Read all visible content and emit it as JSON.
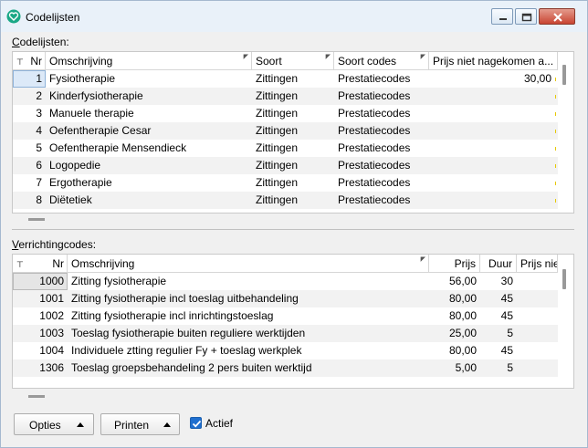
{
  "window": {
    "title": "Codelijsten"
  },
  "codelijsten": {
    "label_prefix": "C",
    "label_rest": "odelijsten:",
    "columns": [
      "Nr",
      "Omschrijving",
      "Soort",
      "Soort codes",
      "Prijs niet nagekomen a..."
    ],
    "rows": [
      {
        "nr": "1",
        "omschrijving": "Fysiotherapie",
        "soort": "Zittingen",
        "soort_codes": "Prestatiecodes",
        "prijs": "30,00"
      },
      {
        "nr": "2",
        "omschrijving": "Kinderfysiotherapie",
        "soort": "Zittingen",
        "soort_codes": "Prestatiecodes",
        "prijs": ""
      },
      {
        "nr": "3",
        "omschrijving": "Manuele therapie",
        "soort": "Zittingen",
        "soort_codes": "Prestatiecodes",
        "prijs": ""
      },
      {
        "nr": "4",
        "omschrijving": "Oefentherapie Cesar",
        "soort": "Zittingen",
        "soort_codes": "Prestatiecodes",
        "prijs": ""
      },
      {
        "nr": "5",
        "omschrijving": "Oefentherapie Mensendieck",
        "soort": "Zittingen",
        "soort_codes": "Prestatiecodes",
        "prijs": ""
      },
      {
        "nr": "6",
        "omschrijving": "Logopedie",
        "soort": "Zittingen",
        "soort_codes": "Prestatiecodes",
        "prijs": ""
      },
      {
        "nr": "7",
        "omschrijving": "Ergotherapie",
        "soort": "Zittingen",
        "soort_codes": "Prestatiecodes",
        "prijs": ""
      },
      {
        "nr": "8",
        "omschrijving": "Diëtetiek",
        "soort": "Zittingen",
        "soort_codes": "Prestatiecodes",
        "prijs": ""
      }
    ]
  },
  "verrichtingcodes": {
    "label_prefix": "V",
    "label_rest": "errichtingcodes:",
    "columns": [
      "Nr",
      "Omschrijving",
      "Prijs",
      "Duur",
      "Prijs nie"
    ],
    "rows": [
      {
        "nr": "1000",
        "omschrijving": "Zitting fysiotherapie",
        "prijs": "56,00",
        "duur": "30"
      },
      {
        "nr": "1001",
        "omschrijving": "Zitting fysiotherapie incl toeslag uitbehandeling",
        "prijs": "80,00",
        "duur": "45"
      },
      {
        "nr": "1002",
        "omschrijving": "Zitting fysiotherapie incl inrichtingstoeslag",
        "prijs": "80,00",
        "duur": "45"
      },
      {
        "nr": "1003",
        "omschrijving": "Toeslag fysiotherapie buiten reguliere werktijden",
        "prijs": "25,00",
        "duur": "5"
      },
      {
        "nr": "1004",
        "omschrijving": "Individuele ztting regulier Fy + toeslag werkplek",
        "prijs": "80,00",
        "duur": "45"
      },
      {
        "nr": "1306",
        "omschrijving": "Toeslag groepsbehandeling 2 pers buiten werktijd",
        "prijs": "5,00",
        "duur": "5"
      }
    ]
  },
  "footer": {
    "opties_label": "Opties",
    "printen_label": "Printen",
    "actief_label": "Actief",
    "actief_checked": true
  },
  "colors": {
    "accent": "#1f6fcf",
    "titlebar": "#e9f1f9",
    "close_button": "#c94532",
    "app_icon": "#1aa886"
  }
}
